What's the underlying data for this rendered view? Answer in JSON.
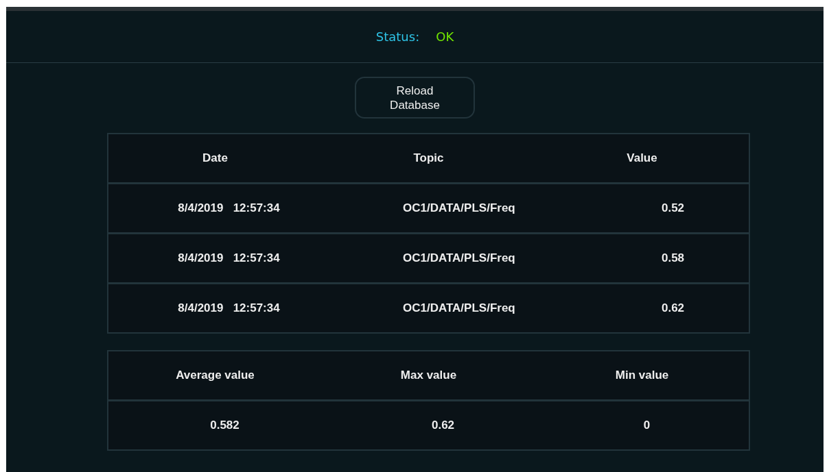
{
  "status": {
    "label": "Status:",
    "value": "OK"
  },
  "reload_button": {
    "label": "Reload\nDatabase"
  },
  "table": {
    "columns": [
      "Date",
      "Topic",
      "Value"
    ],
    "rows": [
      {
        "date": "8/4/2019   12:57:34",
        "topic": "OC1/DATA/PLS/Freq",
        "value": "0.52"
      },
      {
        "date": "8/4/2019   12:57:34",
        "topic": "OC1/DATA/PLS/Freq",
        "value": "0.58"
      },
      {
        "date": "8/4/2019   12:57:34",
        "topic": "OC1/DATA/PLS/Freq",
        "value": "0.62"
      }
    ]
  },
  "summary": {
    "columns": [
      "Average value",
      "Max value",
      "Min value"
    ],
    "values": [
      "0.582",
      "0.62",
      "0"
    ]
  }
}
